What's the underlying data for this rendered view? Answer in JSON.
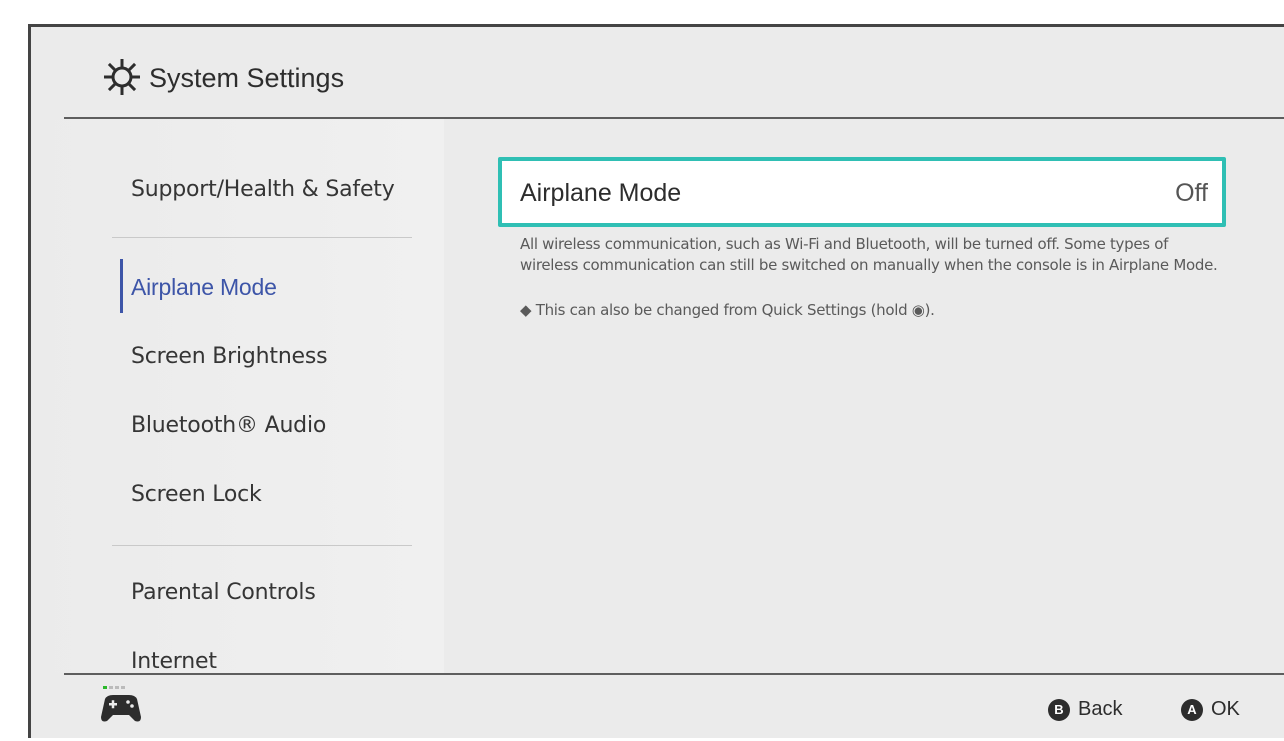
{
  "app": {
    "title": "System Settings",
    "icon": "gear-icon"
  },
  "sidebar": {
    "items": [
      {
        "label": "Support/Health & Safety",
        "selected": false
      },
      {
        "label": "Airplane Mode",
        "selected": true
      },
      {
        "label": "Screen Brightness",
        "selected": false
      },
      {
        "label": "Bluetooth® Audio",
        "selected": false
      },
      {
        "label": "Screen Lock",
        "selected": false
      },
      {
        "label": "Parental Controls",
        "selected": false
      },
      {
        "label": "Internet",
        "selected": false
      }
    ]
  },
  "main": {
    "setting": {
      "label": "Airplane Mode",
      "value": "Off"
    },
    "description": "All wireless communication, such as Wi-Fi and Bluetooth, will be turned off. Some types of wireless communication can still be switched on manually when the console is in Airplane Mode.",
    "note": "◆ This can also be changed from Quick Settings (hold ◉)."
  },
  "footer": {
    "back_button": {
      "glyph": "B",
      "label": "Back"
    },
    "ok_button": {
      "glyph": "A",
      "label": "OK"
    },
    "controller_icon": "controller-icon"
  },
  "colors": {
    "accent_highlight": "#2fbfb4",
    "selected_text": "#3d55a8",
    "background": "#ebebeb"
  }
}
